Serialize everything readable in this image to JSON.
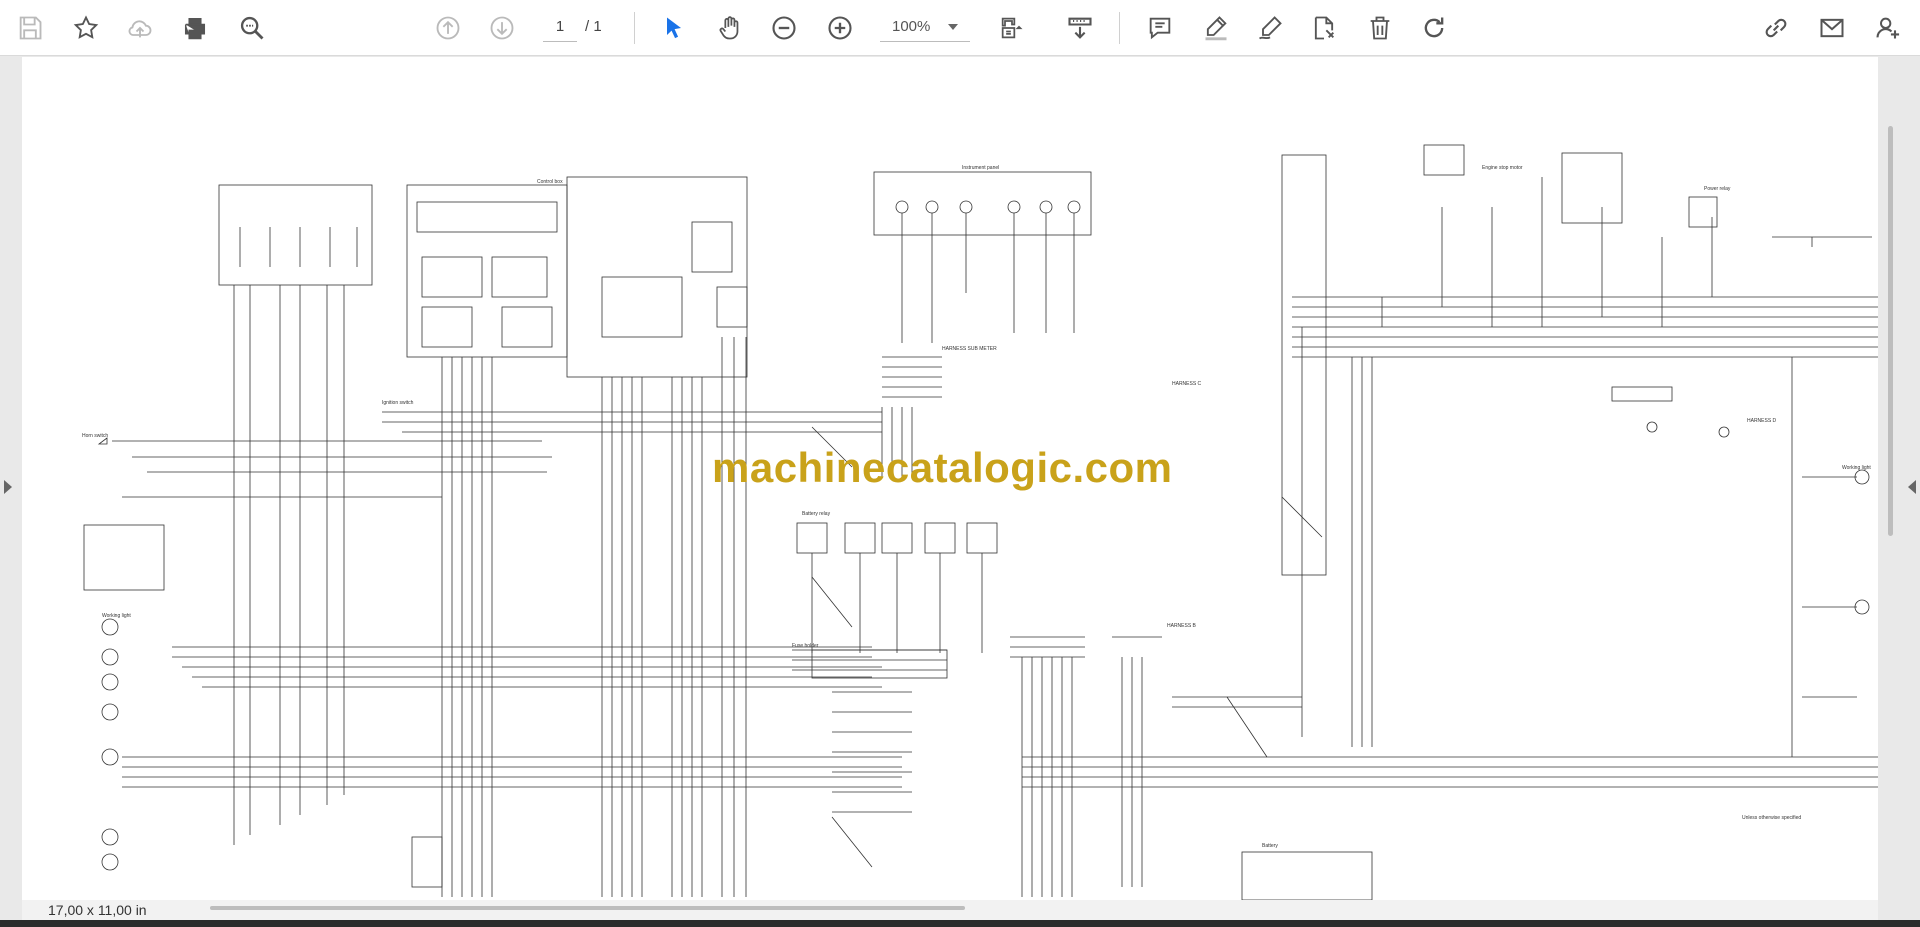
{
  "toolbar": {
    "icons": [
      "save-icon",
      "bookmark-star-icon",
      "upload-cloud-icon",
      "print-icon",
      "zoom-search-icon",
      "previous-page-icon",
      "next-page-icon",
      "select-cursor-icon",
      "hand-pan-icon",
      "zoom-out-icon",
      "zoom-in-icon",
      "zoom-caret-icon",
      "page-fit-icon",
      "scroll-mode-icon",
      "comment-icon",
      "highlight-pen-icon",
      "draw-pen-icon",
      "stamp-icon",
      "delete-trash-icon",
      "rotate-icon",
      "share-link-icon",
      "email-icon",
      "add-user-icon"
    ],
    "current_page": "1",
    "page_total": "/ 1",
    "zoom": "100%"
  },
  "document": {
    "watermark": "machinecatalogic.com",
    "page_size": "17,00 x 11,00 in"
  },
  "colors": {
    "accent": "#1a73e8",
    "watermark": "#c9a21a",
    "toolbar_bg": "#ffffff",
    "viewer_bg": "#e9e9e9"
  }
}
